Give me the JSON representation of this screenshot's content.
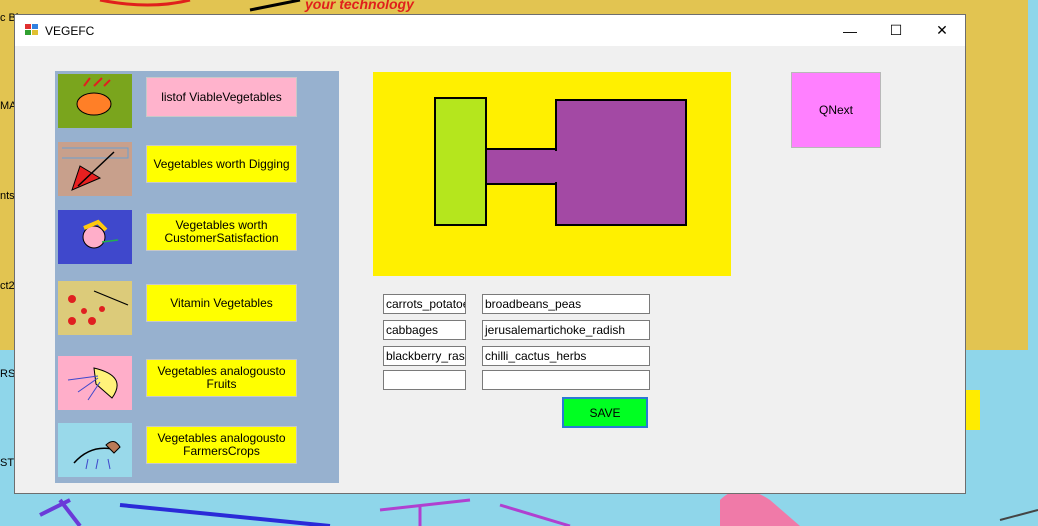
{
  "desktop": {
    "top_text": "your technology",
    "side_labels": [
      "c Bi",
      "MA",
      "nts",
      "ct2",
      "RS",
      "ST"
    ]
  },
  "window": {
    "title": "VEGEFC",
    "controls": {
      "minimize": "—",
      "maximize": "☐",
      "close": "✕"
    }
  },
  "menu": [
    {
      "label": "listof ViableVegetables"
    },
    {
      "label": "Vegetables worth Digging"
    },
    {
      "label": "Vegetables worth CustomerSatisfaction"
    },
    {
      "label": "Vitamin Vegetables"
    },
    {
      "label": "Vegetables analogousto Fruits"
    },
    {
      "label": "Vegetables analogousto FarmersCrops"
    }
  ],
  "qnext_label": "QNext",
  "fields_left": [
    "carrots_potatoes",
    "cabbages",
    "blackberry_raspberry",
    ""
  ],
  "fields_right": [
    "broadbeans_peas",
    "jerusalemartichoke_radish",
    "chilli_cactus_herbs",
    ""
  ],
  "save_label": "SAVE",
  "colors": {
    "panel": "#97b1cf",
    "menu_button": "#ffff00",
    "menu_button_selected": "#ffb3cc",
    "drawing_bg": "#fff000",
    "qnext": "#ff80ff",
    "save": "#00ff22",
    "shape_green": "#b5e61d",
    "shape_purple": "#a349a4"
  }
}
